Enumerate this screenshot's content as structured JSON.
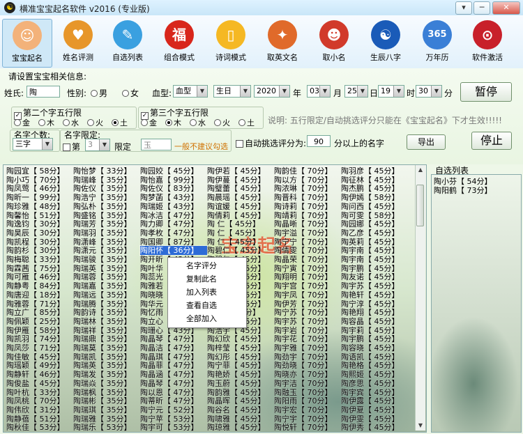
{
  "window": {
    "title": "横准宝宝起名软件 v2016 (专业版)",
    "btn_menu": "▾",
    "btn_min": "─",
    "btn_close": "✕"
  },
  "toolbar": [
    {
      "label": "宝宝起名",
      "icon": "baby-face-icon",
      "glyph": "☺",
      "color": "#f3b27a"
    },
    {
      "label": "姓名评测",
      "icon": "kids-icon",
      "glyph": "♥",
      "color": "#e7962a"
    },
    {
      "label": "自选列表",
      "icon": "bird-books-icon",
      "glyph": "✎",
      "color": "#3aa0e0"
    },
    {
      "label": "组合模式",
      "icon": "lantern-icon",
      "glyph": "福",
      "color": "#d8261b"
    },
    {
      "label": "诗词模式",
      "icon": "book-icon",
      "glyph": "▯",
      "color": "#f5b823"
    },
    {
      "label": "取英文名",
      "icon": "owl-icon",
      "glyph": "✦",
      "color": "#e06a2a"
    },
    {
      "label": "取小名",
      "icon": "cartoon-face-icon",
      "glyph": "☻",
      "color": "#d13a2a"
    },
    {
      "label": "生辰八字",
      "icon": "yin-yang-icon",
      "glyph": "☯",
      "color": "#1a5bb8"
    },
    {
      "label": "万年历",
      "icon": "calendar-icon",
      "glyph": "365",
      "color": "#3a7fd6"
    },
    {
      "label": "软件激活",
      "icon": "lock-icon",
      "glyph": "⊙",
      "color": "#c8202a"
    }
  ],
  "form": {
    "section_label": "请设置宝宝相关信息:",
    "surname_label": "姓氏:",
    "surname_value": "陶",
    "gender_label": "性别:",
    "gender_male": "男",
    "gender_female": "女",
    "blood_label": "血型:",
    "blood_value": "血型",
    "birthday_value": "生日",
    "year_value": "2020",
    "year_unit": "年",
    "month_value": "03",
    "month_unit": "月",
    "day_value": "25",
    "day_unit": "日",
    "hour_value": "19",
    "hour_unit": "时",
    "minute_value": "30",
    "minute_unit": "分",
    "pause_button": "暂停",
    "second_char_check": "第二个字五行限",
    "third_char_check": "第三个字五行限",
    "wuxing": [
      "金",
      "木",
      "水",
      "火",
      "土"
    ],
    "note": "说明: 五行限定/自动挑选评分只能在《宝宝起名》下才生效!!!!!",
    "name_count_label": "名字个数:",
    "name_count_value": "三字",
    "name_limit_label": "名字限定:",
    "limit_pos_label": "第",
    "limit_pos_value": "3",
    "limit_label": "限定",
    "limit_char_value": "玉",
    "limit_hint": "一般不建议勾选",
    "auto_pick_label": "自动挑选评分为:",
    "auto_pick_value": "90",
    "auto_pick_suffix": "分以上的名字",
    "export_button": "导出",
    "stop_button": "停止"
  },
  "results": {
    "columns": [
      [
        "陶园宜【 58分】",
        "陶小巧【 70分】",
        "陶凤莺【 46分】",
        "陶昕一【 99分】",
        "陶珍雅【 48分】",
        "陶馨怡【 51分】",
        "陶逸钧【 30分】",
        "陶昊辰【 30分】",
        "陶凯程【 30分】",
        "陶韵杉【 30分】",
        "陶梅聪【 33分】",
        "陶霖茜【 75分】",
        "陶可雁【 46分】",
        "陶静粤【 84分】",
        "陶唐迎【 18分】",
        "陶雅蓉【 71分】",
        "陶立广【 85分】",
        "陶佩颖【 25分】",
        "陶伊雁【 58分】",
        "陶凯羽【 74分】",
        "陶凤莎【 71分】",
        "陶佳敏【 45分】",
        "陶瑶颖【 49分】",
        "陶静轩【 46分】",
        "陶俊盐【 45分】",
        "陶叶杭【 33分】",
        "陶凤桃【 70分】",
        "陶伟欣【 31分】",
        "陶静蓓【 51分】",
        "陶秋佳【 53分】"
      ],
      [
        "陶怡梦【 33分】",
        "陶瑞峰【 35分】",
        "陶佐仪【 35分】",
        "陶浩宁【 35分】",
        "陶弘朴【 35分】",
        "陶盛铭【 35分】",
        "陶瑞芳【 35分】",
        "陶瑞羽【 35分】",
        "陶潇峰【 35分】",
        "陶潇元【 35分】",
        "陶瑞骏【 35分】",
        "陶瑞英【 35分】",
        "陶瑞蓉【 35分】",
        "陶瑞嘉【 35分】",
        "陶瑞远【 35分】",
        "陶瑞腾【 35分】",
        "陶韵诗【 35分】",
        "陶瑞林【 35分】",
        "陶瑞祥【 35分】",
        "陶瑞鼎【 35分】",
        "陶瑞莫【 35分】",
        "陶瑞凯【 35分】",
        "陶瑞英【 35分】",
        "陶瑞发【 35分】",
        "陶瑞焱【 35分】",
        "陶瑞枫【 35分】",
        "陶瑞彬【 35分】",
        "陶瑞琪【 35分】",
        "陶瑞雅【 35分】",
        "陶瑞乐【 53分】"
      ],
      [
        "陶园姣【 45分】",
        "陶怡嘉【 99分】",
        "陶佐仪【 83分】",
        "陶梦菡【 43分】",
        "陶瑞姬【 43分】",
        "陶冰洁【 47分】",
        "陶力卿【 47分】",
        "陶孝枚【 47分】",
        "陶国卿【 87分】",
        "陶阳怀【 36分】",
        "陶开昕【 42分】",
        "陶叶华【 44分】",
        "陶蕊光【 47分】",
        "陶雅若【 47分】",
        "陶晓晓【 47分】",
        "陶华元【 47分】",
        "陶忆雨【 47分】",
        "陶立心【 41分】",
        "陶珊心【 43分】",
        "陶晶琴【 47分】",
        "陶晶洁【 47分】",
        "陶晶琪【 47分】",
        "陶晶菲【 47分】",
        "陶晶涵【 47分】",
        "陶晶琴【 47分】",
        "陶以恩【 47分】",
        "陶蒂昕【 47分】",
        "陶宁元【 52分】",
        "陶宁苹【 53分】",
        "陶宇可【 53分】"
      ],
      [
        "陶伊若【 45分】",
        "陶伊蔓【 45分】",
        "陶璧蕾【 45分】",
        "陶晨瑶【 45分】",
        "陶谊媛【 45分】",
        "陶倩莉【 45分】",
        "陶 仁【 45分】",
        "陶 仁【 45分】",
        "陶 仁【 45分】",
        "陶碧仁【 45分】",
        "陶碧仁【 45分】",
        "陶碧仁【 45分】",
        "陶雪飘【 45分】",
        "陶薇彤【 45分】",
        "陶宁元【 45分】",
        "陶宇奇【 45分】",
        "陶钰 【 45分】",
        "陶珍忆【 45分】",
        "陶浩宇【 45分】",
        "陶幻欣【 45分】",
        "陶梓莹【 45分】",
        "陶幻彤【 45分】",
        "陶宁菲【 45分】",
        "陶艳娇【 45分】",
        "陶玉蔚【 45分】",
        "陶韵雅【 45分】",
        "陶晶晖【 45分】",
        "陶谷名【 45分】",
        "陶啸雅【 45分】",
        "陶琼雅【 45分】"
      ],
      [
        "陶韵佳【 70分】",
        "陶以方【 70分】",
        "陶浓琳【 70分】",
        "陶晋科【 70分】",
        "陶诗莉【 70分】",
        "陶靖莉【 70分】",
        "陶晶晰【 70分】",
        "陶宇溢【 70分】",
        "陶宁宁【 70分】",
        "陶倩雯【 70分】",
        "陶晶荣【 70分】",
        "陶宁寅【 70分】",
        "陶翔明【 70分】",
        "陶宇宫【 70分】",
        "陶宇凤【 70分】",
        "陶伊芳【 70分】",
        "陶宁苏【 70分】",
        "陶宇苏【 70分】",
        "陶宇岩【 70分】",
        "陶宇花【 70分】",
        "陶宇雅【 70分】",
        "陶劲宇【 70分】",
        "陶劲晓【 70分】",
        "陶晓亦【 70分】",
        "陶宇洁【 70分】",
        "陶融玉【 70分】",
        "陶阳雨【 70分】",
        "陶宇宏【 70分】",
        "陶宁宇【 70分】",
        "陶悦轩【 70分】"
      ],
      [
        "陶羽彦【 45分】",
        "陶征林【 45分】",
        "陶杰鹏【 45分】",
        "陶伊嫣【 58分】",
        "陶问西【 45分】",
        "陶可雯【 58分】",
        "陶园娜【 45分】",
        "陶乙彦【 45分】",
        "陶英莉【 45分】",
        "陶宇南【 45分】",
        "陶宇南【 45分】",
        "陶宇鹏【 45分】",
        "陶友诺【 45分】",
        "陶宇苏【 45分】",
        "陶艳轩【 45分】",
        "陶宁淳【 45分】",
        "陶艳翔【 45分】",
        "陶容晶【 45分】",
        "陶宇莉【 45分】",
        "陶宇鹏【 45分】",
        "陶容晓【 45分】",
        "陶语凯【 45分】",
        "陶艳格【 45分】",
        "陶熙姬【 45分】",
        "陶彦思【 45分】",
        "陶宇宾【 45分】",
        "陶伊露【 45分】",
        "陶伊夏【 45分】",
        "陶伊雯【 45分】",
        "陶伊秀【 45分】"
      ]
    ],
    "selected": {
      "col": 2,
      "row": 9
    }
  },
  "self_list": {
    "header": "自选列表",
    "items": [
      "陶小芬【 54分】",
      "陶阳鹤【 73分】"
    ]
  },
  "context_menu": [
    "名字评分",
    "复制此名",
    "加入列表",
    "查看自选",
    "全部加入"
  ],
  "watermark": "宝宝起名"
}
